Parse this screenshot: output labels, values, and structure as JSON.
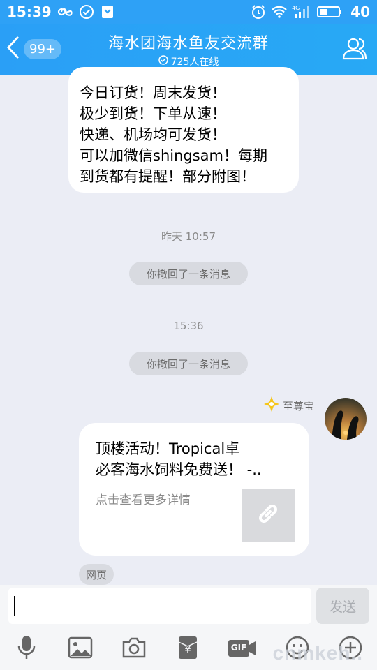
{
  "status_bar": {
    "time": "15:39",
    "network_label": "4G",
    "battery": "40"
  },
  "header": {
    "back_badge": "99+",
    "title": "海水团海水鱼友交流群",
    "online": "725人在线"
  },
  "messages": {
    "top_bubble": [
      "今日订货！周末发货！",
      "极少到货！下单从速！",
      "快递、机场均可发货！",
      "可以加微信shingsam！每期",
      "到货都有提醒！部分附图！"
    ],
    "timestamp_1": "昨天 10:57",
    "recall_1": "你撤回了一条消息",
    "timestamp_2": "15:36",
    "recall_2": "你撤回了一条消息",
    "sender_title": "至尊宝",
    "card": {
      "title_line1": "顶楼活动！Tropical卓",
      "title_line2": "必客海水饲料免费送！ -..",
      "subtitle": "点击查看更多详情"
    },
    "source_tag": "网页"
  },
  "input_bar": {
    "value": "",
    "send_label": "发送"
  },
  "toolbar": {
    "gif_label": "GIF"
  },
  "watermark": "cnmkeh..",
  "colors": {
    "header_blue": "#2ea1f6",
    "chat_background": "#ebedf5",
    "badge_gold": "#f5c518"
  },
  "icons": [
    "infinity-icon",
    "check-circle-icon",
    "shield-icon",
    "alarm-icon",
    "wifi-icon",
    "signal-icon",
    "battery-icon",
    "back-chevron-icon",
    "members-icon",
    "link-icon",
    "mic-icon",
    "image-icon",
    "camera-icon",
    "red-packet-icon",
    "gif-icon",
    "emoji-icon",
    "plus-icon",
    "diamond-badge-icon"
  ]
}
